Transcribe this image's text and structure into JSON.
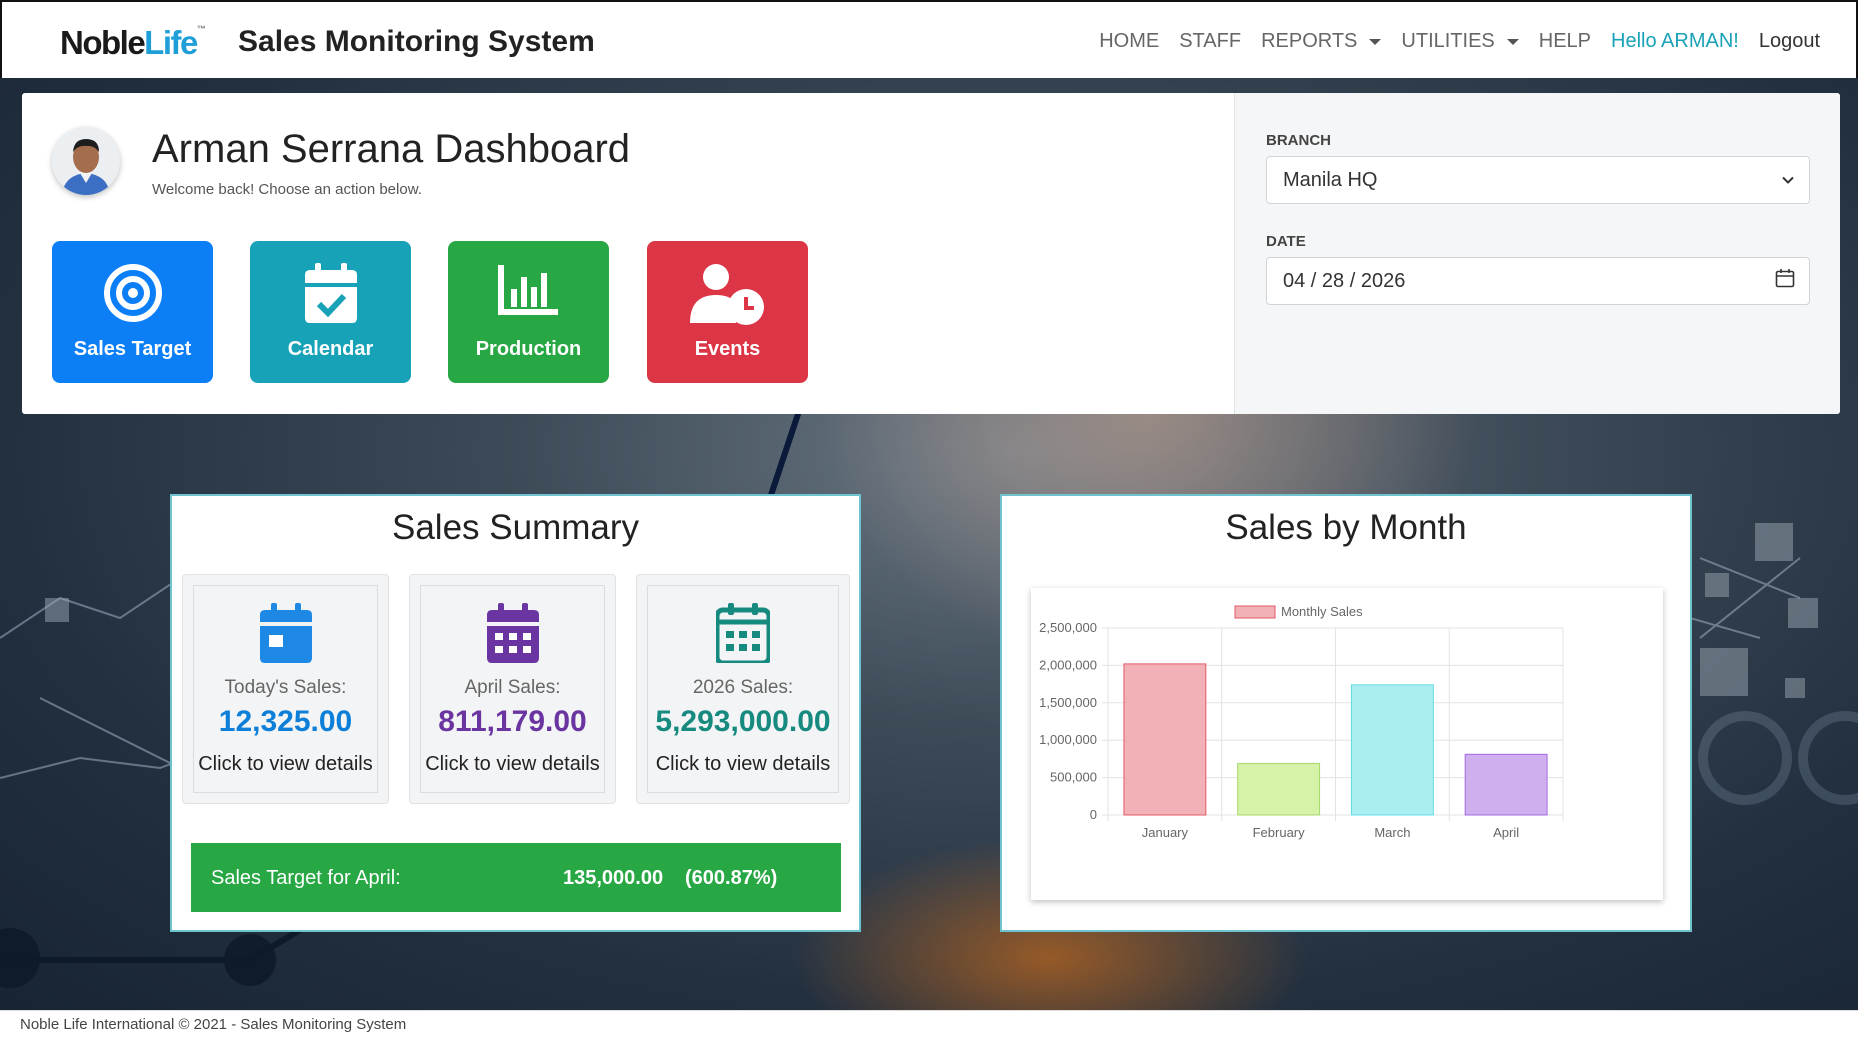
{
  "brand": {
    "logo_noble": "Noble",
    "logo_life": "Life",
    "logo_tm": "™",
    "app_title": "Sales Monitoring System"
  },
  "nav": {
    "home": "HOME",
    "staff": "STAFF",
    "reports": "REPORTS",
    "utilities": "UTILITIES",
    "help": "HELP",
    "greeting": "Hello ARMAN!",
    "logout": "Logout"
  },
  "dashboard": {
    "title": "Arman Serrana Dashboard",
    "subtitle": "Welcome back! Choose an action below.",
    "actions": [
      {
        "label": "Sales Target",
        "icon": "target-icon"
      },
      {
        "label": "Calendar",
        "icon": "calendar-check-icon"
      },
      {
        "label": "Production",
        "icon": "bar-chart-icon"
      },
      {
        "label": "Events",
        "icon": "user-clock-icon"
      }
    ]
  },
  "filters": {
    "branch_label": "BRANCH",
    "branch_value": "Manila HQ",
    "date_label": "DATE",
    "date_value": "04 / 28 / 2026"
  },
  "summary": {
    "title": "Sales Summary",
    "stats": [
      {
        "label": "Today's Sales:",
        "value": "12,325.00",
        "link": "Click to view details",
        "color": "#0d7fd8"
      },
      {
        "label": "April Sales:",
        "value": "811,179.00",
        "link": "Click to view details",
        "color": "#6a35a0"
      },
      {
        "label": "2026 Sales:",
        "value": "5,293,000.00",
        "link": "Click to view details",
        "color": "#178a80"
      }
    ],
    "target": {
      "label": "Sales Target for April:",
      "amount": "135,000.00",
      "percent": "(600.87%)"
    }
  },
  "chart_card": {
    "title": "Sales by Month"
  },
  "chart_data": {
    "type": "bar",
    "categories": [
      "January",
      "February",
      "March",
      "April"
    ],
    "series": [
      {
        "name": "Monthly Sales",
        "values": [
          2020000,
          690000,
          1740000,
          811179
        ]
      }
    ],
    "ylim": [
      0,
      2500000
    ],
    "yticks": [
      "0",
      "500,000",
      "1,000,000",
      "1,500,000",
      "2,000,000",
      "2,500,000"
    ],
    "bar_fills": [
      "#f2b1b6",
      "#d6f2a8",
      "#a9eef0",
      "#d0afef"
    ],
    "bar_strokes": [
      "#e05a67",
      "#a5d86a",
      "#5fdde3",
      "#a46be0"
    ],
    "legend_position": "top",
    "grid": true
  },
  "footer": {
    "text": "Noble Life International © 2021 - Sales Monitoring System"
  }
}
